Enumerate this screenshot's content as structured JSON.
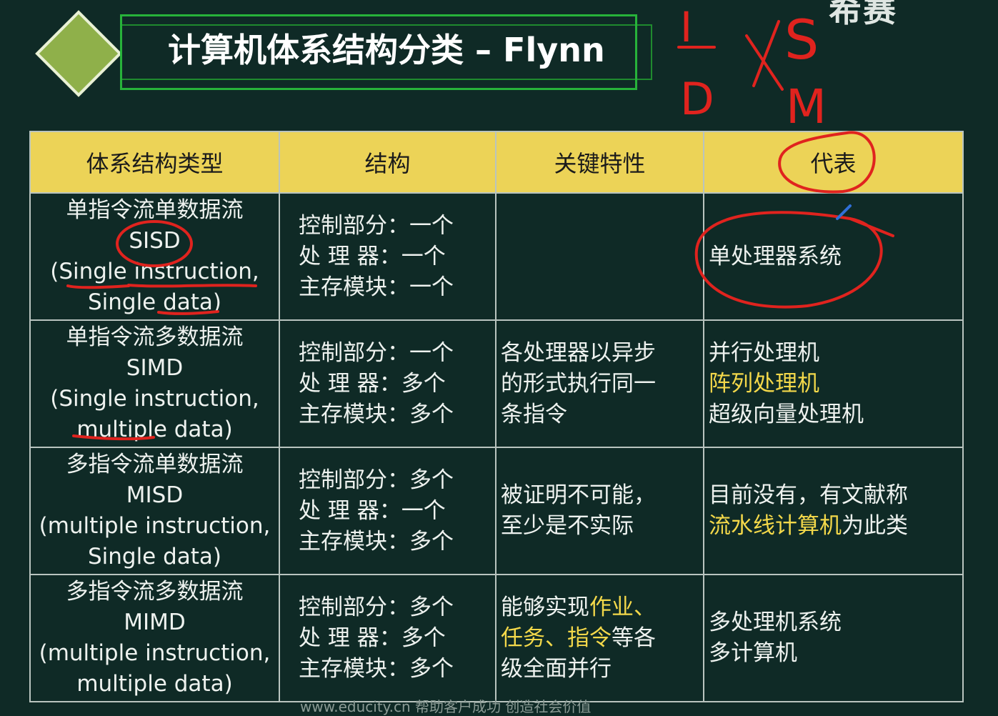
{
  "slide": {
    "title": "计算机体系结构分类 – Flynn",
    "logo_text": "希赛",
    "footer": "www.educity.cn    帮助客户成功  创造社会价值"
  },
  "table": {
    "headers": [
      "体系结构类型",
      "结构",
      "关键特性",
      "代表"
    ],
    "rows": [
      {
        "type_cn": "单指令流单数据流",
        "type_abbr": "SISD",
        "type_en_1": "(Single instruction,",
        "type_en_2": "Single data)",
        "struct": [
          "控制部分：一个",
          "处 理 器：一个",
          "主存模块：一个"
        ],
        "feature": [],
        "rep": [
          "单处理器系统"
        ]
      },
      {
        "type_cn": "单指令流多数据流",
        "type_abbr": "SIMD",
        "type_en_1": "(Single instruction,",
        "type_en_2": "multiple data)",
        "struct": [
          "控制部分：一个",
          "处 理 器：多个",
          "主存模块：多个"
        ],
        "feature": [
          "各处理器以异步",
          "的形式执行同一",
          "条指令"
        ],
        "rep": [
          "并行处理机",
          "阵列处理机",
          "超级向量处理机"
        ]
      },
      {
        "type_cn": "多指令流单数据流",
        "type_abbr": "MISD",
        "type_en_1": "(multiple instruction,",
        "type_en_2": "Single data)",
        "struct": [
          "控制部分：多个",
          "处 理 器：一个",
          "主存模块：多个"
        ],
        "feature": [
          "被证明不可能，",
          "至少是不实际"
        ],
        "rep_line1": "目前没有，有文献称",
        "rep_line2_hl": "流水线计算机",
        "rep_line2_rest": "为此类"
      },
      {
        "type_cn": "多指令流多数据流",
        "type_abbr": "MIMD",
        "type_en_1": "(multiple instruction,",
        "type_en_2": "multiple data)",
        "struct": [
          "控制部分：多个",
          "处 理 器：多个",
          "主存模块：多个"
        ],
        "feature_l1_a": "能够实现",
        "feature_l1_hl": "作业、",
        "feature_l2_hl": "任务、指令",
        "feature_l2_b": "等各",
        "feature_l3": "级全面并行",
        "rep": [
          "多处理机系统",
          "多计算机"
        ]
      }
    ]
  },
  "annotation": {
    "letters": [
      "I",
      "D",
      "S",
      "M"
    ]
  },
  "colors": {
    "background": "#0f2a26",
    "header": "#ecd357",
    "highlight": "#f3d84a",
    "ink": "#e0231e"
  }
}
